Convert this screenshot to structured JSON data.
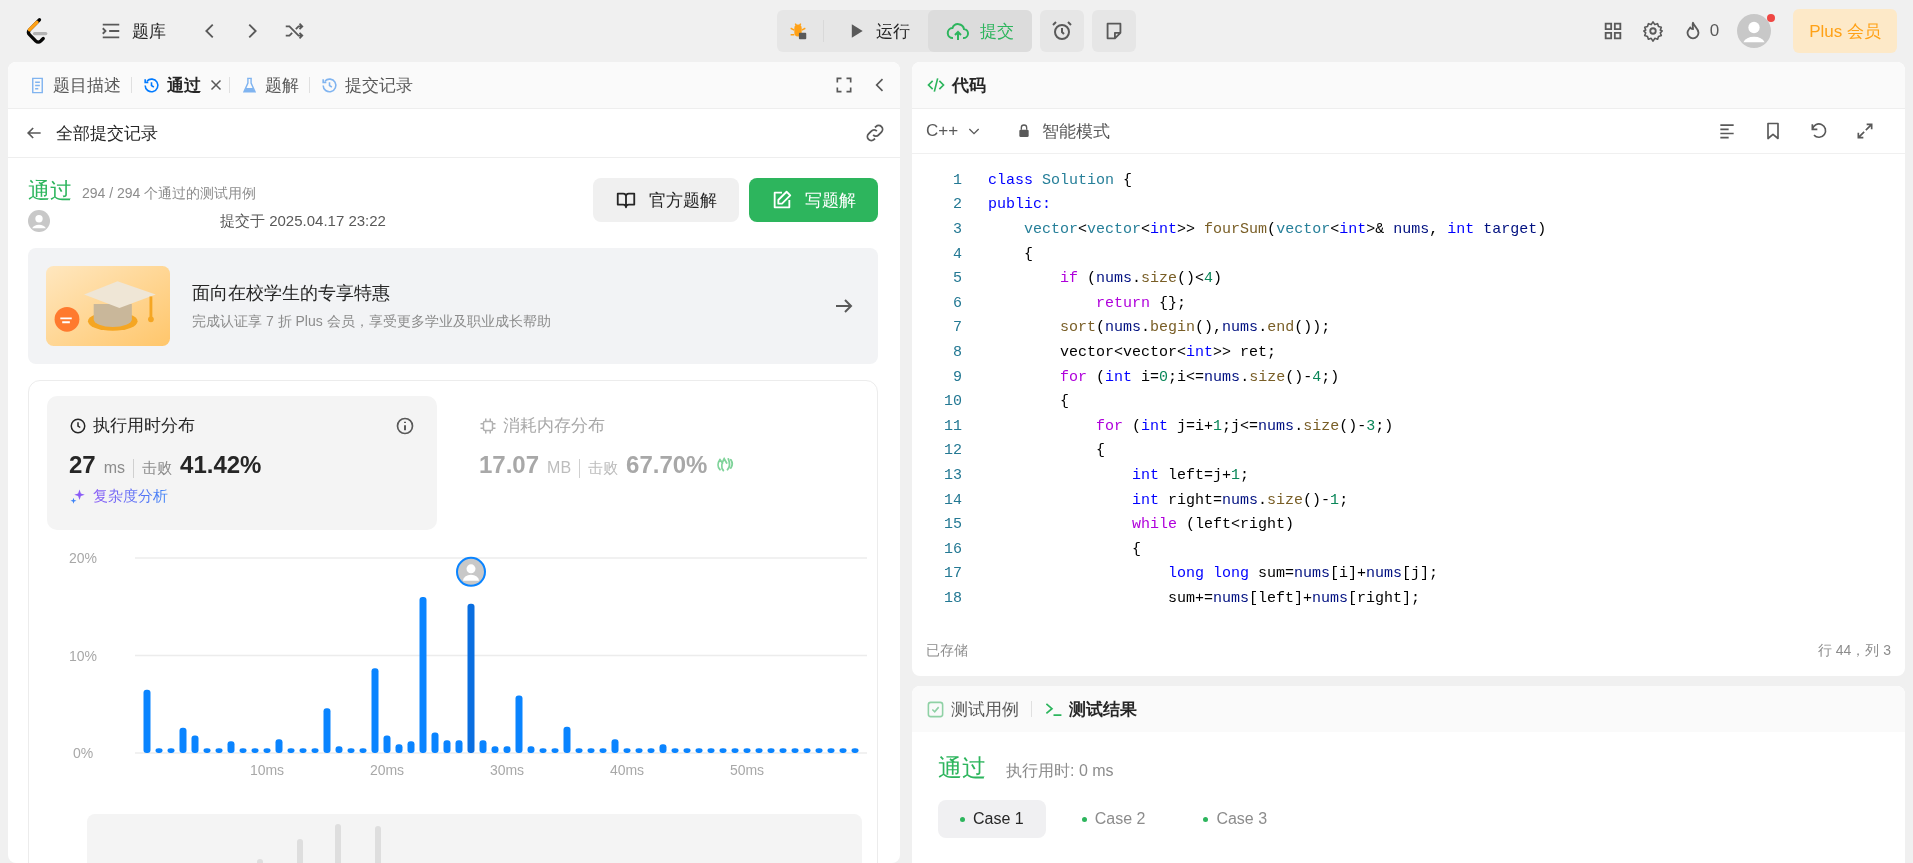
{
  "topbar": {
    "nav_label": "题库",
    "run": "运行",
    "submit": "提交",
    "streak": "0",
    "has_notification": true,
    "plus": "Plus 会员"
  },
  "left_tabs": [
    {
      "label": "题目描述",
      "kind": "description",
      "selected": false,
      "closable": false
    },
    {
      "label": "通过",
      "kind": "result",
      "selected": true,
      "closable": true
    },
    {
      "label": "题解",
      "kind": "solutions",
      "selected": false,
      "closable": false
    },
    {
      "label": "提交记录",
      "kind": "submissions",
      "selected": false,
      "closable": false
    }
  ],
  "back_label": "全部提交记录",
  "result": {
    "status": "通过",
    "passed": "294 / 294 个通过的测试用例",
    "submitted": "提交于 2025.04.17 23:22",
    "buttons": [
      {
        "label": "官方题解",
        "kind": "secondary"
      },
      {
        "label": "写题解",
        "kind": "primary"
      }
    ]
  },
  "promo": {
    "title": "面向在校学生的专享特惠",
    "subtitle": "完成认证享 7 折 Plus 会员，享受更多学业及职业成长帮助"
  },
  "stats": [
    {
      "title": "执行用时分布",
      "kind": "runtime",
      "value": "27",
      "unit": "ms",
      "beat_label": "击败",
      "beat": "41.42%",
      "selected": true,
      "link": "复杂度分析"
    },
    {
      "title": "消耗内存分布",
      "kind": "memory",
      "value": "17.07",
      "unit": "MB",
      "beat_label": "击败",
      "beat": "67.70%",
      "selected": false
    }
  ],
  "chart_data": {
    "type": "bar",
    "x": [
      0,
      1,
      2,
      3,
      4,
      5,
      6,
      7,
      8,
      9,
      10,
      11,
      12,
      13,
      14,
      15,
      16,
      17,
      18,
      19,
      20,
      21,
      22,
      23,
      24,
      25,
      26,
      27,
      28,
      29,
      30,
      31,
      32,
      33,
      34,
      35,
      36,
      37,
      38,
      39,
      40,
      41,
      42,
      43,
      44,
      45,
      46,
      47,
      48,
      49,
      50,
      51,
      52,
      53,
      54,
      55,
      56,
      57,
      58,
      59
    ],
    "values": [
      6.5,
      0.5,
      0.5,
      2.6,
      1.8,
      0.5,
      0.5,
      1.2,
      0.5,
      0.5,
      0.5,
      1.4,
      0.5,
      0.5,
      0.5,
      4.6,
      0.7,
      0.5,
      0.5,
      8.7,
      1.8,
      0.9,
      1.2,
      16.0,
      2.1,
      1.3,
      1.3,
      15.3,
      1.3,
      0.7,
      0.7,
      5.9,
      0.7,
      0.5,
      0.5,
      2.7,
      0.5,
      0.5,
      0.5,
      1.4,
      0.5,
      0.5,
      0.5,
      0.9,
      0.5,
      0.5,
      0.5,
      0.5,
      0.5,
      0.5,
      0.5,
      0.5,
      0.5,
      0.5,
      0.5,
      0.5,
      0.5,
      0.5,
      0.5,
      0.5
    ],
    "xlim": [
      -1,
      60
    ],
    "ylim": [
      0,
      20
    ],
    "yticks": [
      {
        "value": 0,
        "label": "0%"
      },
      {
        "value": 10,
        "label": "10%"
      },
      {
        "value": 20,
        "label": "20%"
      }
    ],
    "xticks": [
      {
        "value": 10,
        "label": "10ms"
      },
      {
        "value": 20,
        "label": "20ms"
      },
      {
        "value": 30,
        "label": "30ms"
      },
      {
        "value": 40,
        "label": "40ms"
      },
      {
        "value": 50,
        "label": "50ms"
      }
    ],
    "data_labels": false
  },
  "editor": {
    "title": "代码",
    "language": "C++",
    "mode": "智能模式",
    "status": "已存储",
    "cursor": "行 44，列 3",
    "lines": [
      {
        "number": "1",
        "tokens": [
          {
            "text": "class",
            "kind": "keyword"
          },
          {
            "text": " Solution",
            "kind": "type"
          },
          {
            "text": " {"
          }
        ]
      },
      {
        "number": "2",
        "tokens": [
          {
            "text": "public:",
            "kind": "keyword"
          }
        ]
      },
      {
        "number": "3",
        "tokens": [
          {
            "text": "    vector",
            "kind": "type"
          },
          {
            "text": "<"
          },
          {
            "text": "vector",
            "kind": "type"
          },
          {
            "text": "<"
          },
          {
            "text": "int",
            "kind": "keyword"
          },
          {
            "text": ">> "
          },
          {
            "text": "fourSum",
            "kind": "function"
          },
          {
            "text": "("
          },
          {
            "text": "vector",
            "kind": "type"
          },
          {
            "text": "<"
          },
          {
            "text": "int",
            "kind": "keyword"
          },
          {
            "text": ">& "
          },
          {
            "text": "nums",
            "kind": "variable"
          },
          {
            "text": ", "
          },
          {
            "text": "int",
            "kind": "keyword"
          },
          {
            "text": " target",
            "kind": "variable"
          },
          {
            "text": ")"
          }
        ]
      },
      {
        "number": "4",
        "tokens": [
          {
            "text": "    {"
          }
        ]
      },
      {
        "number": "5",
        "tokens": [
          {
            "text": "        if",
            "kind": "control"
          },
          {
            "text": " ("
          },
          {
            "text": "nums",
            "kind": "variable"
          },
          {
            "text": "."
          },
          {
            "text": "size",
            "kind": "function"
          },
          {
            "text": "()<"
          },
          {
            "text": "4",
            "kind": "number"
          },
          {
            "text": ")"
          }
        ]
      },
      {
        "number": "6",
        "tokens": [
          {
            "text": "            return",
            "kind": "control"
          },
          {
            "text": " {};"
          }
        ]
      },
      {
        "number": "7",
        "tokens": [
          {
            "text": "        sort",
            "kind": "function"
          },
          {
            "text": "("
          },
          {
            "text": "nums",
            "kind": "variable"
          },
          {
            "text": "."
          },
          {
            "text": "begin",
            "kind": "function"
          },
          {
            "text": "(),"
          },
          {
            "text": "nums",
            "kind": "variable"
          },
          {
            "text": "."
          },
          {
            "text": "end",
            "kind": "function"
          },
          {
            "text": "());"
          }
        ]
      },
      {
        "number": "8",
        "tokens": [
          {
            "text": "        vector<vector<"
          },
          {
            "text": "int",
            "kind": "keyword"
          },
          {
            "text": ">> ret;"
          }
        ]
      },
      {
        "number": "9",
        "tokens": [
          {
            "text": "        for",
            "kind": "control"
          },
          {
            "text": " ("
          },
          {
            "text": "int",
            "kind": "keyword"
          },
          {
            "text": " i="
          },
          {
            "text": "0",
            "kind": "number"
          },
          {
            "text": ";i<="
          },
          {
            "text": "nums",
            "kind": "variable"
          },
          {
            "text": "."
          },
          {
            "text": "size",
            "kind": "function"
          },
          {
            "text": "()-"
          },
          {
            "text": "4",
            "kind": "number"
          },
          {
            "text": ";)"
          }
        ]
      },
      {
        "number": "10",
        "tokens": [
          {
            "text": "        {"
          }
        ]
      },
      {
        "number": "11",
        "tokens": [
          {
            "text": "            for",
            "kind": "control"
          },
          {
            "text": " ("
          },
          {
            "text": "int",
            "kind": "keyword"
          },
          {
            "text": " j=i+"
          },
          {
            "text": "1",
            "kind": "number"
          },
          {
            "text": ";j<="
          },
          {
            "text": "nums",
            "kind": "variable"
          },
          {
            "text": "."
          },
          {
            "text": "size",
            "kind": "function"
          },
          {
            "text": "()-"
          },
          {
            "text": "3",
            "kind": "number"
          },
          {
            "text": ";)"
          }
        ]
      },
      {
        "number": "12",
        "tokens": [
          {
            "text": "            {"
          }
        ]
      },
      {
        "number": "13",
        "tokens": [
          {
            "text": "                int",
            "kind": "keyword"
          },
          {
            "text": " left=j+"
          },
          {
            "text": "1",
            "kind": "number"
          },
          {
            "text": ";"
          }
        ]
      },
      {
        "number": "14",
        "tokens": [
          {
            "text": "                int",
            "kind": "keyword"
          },
          {
            "text": " right="
          },
          {
            "text": "nums",
            "kind": "variable"
          },
          {
            "text": "."
          },
          {
            "text": "size",
            "kind": "function"
          },
          {
            "text": "()-"
          },
          {
            "text": "1",
            "kind": "number"
          },
          {
            "text": ";"
          }
        ]
      },
      {
        "number": "15",
        "tokens": [
          {
            "text": "                while",
            "kind": "control"
          },
          {
            "text": " (left<right)"
          }
        ]
      },
      {
        "number": "16",
        "tokens": [
          {
            "text": "                {"
          }
        ]
      },
      {
        "number": "17",
        "tokens": [
          {
            "text": "                    long long",
            "kind": "keyword"
          },
          {
            "text": " sum="
          },
          {
            "text": "nums",
            "kind": "variable"
          },
          {
            "text": "[i]+"
          },
          {
            "text": "nums",
            "kind": "variable"
          },
          {
            "text": "[j];"
          }
        ]
      },
      {
        "number": "18",
        "tokens": [
          {
            "text": "                    sum+="
          },
          {
            "text": "nums",
            "kind": "variable"
          },
          {
            "text": "[left]+"
          },
          {
            "text": "nums",
            "kind": "variable"
          },
          {
            "text": "[right];"
          }
        ]
      }
    ]
  },
  "console": {
    "tabs": [
      {
        "label": "测试用例",
        "kind": "testcase",
        "selected": false
      },
      {
        "label": "测试结果",
        "kind": "result",
        "selected": true
      }
    ],
    "status": "通过",
    "runtime": "执行用时: 0 ms",
    "cases": [
      {
        "label": "Case 1",
        "selected": true,
        "passed": true
      },
      {
        "label": "Case 2",
        "selected": false,
        "passed": true
      },
      {
        "label": "Case 3",
        "selected": false,
        "passed": true
      }
    ]
  }
}
